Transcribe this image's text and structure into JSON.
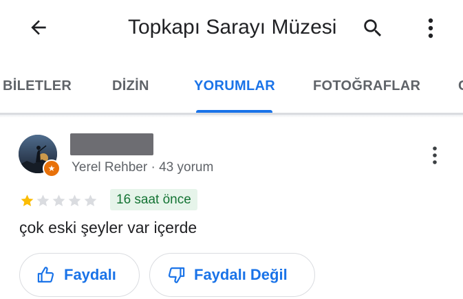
{
  "app_bar": {
    "title": "Topkapı Sarayı Müzesi",
    "icons": [
      "back-arrow-icon",
      "search-icon",
      "more-vert-icon"
    ]
  },
  "tabs": [
    {
      "label": "BİLETLER",
      "active": false
    },
    {
      "label": "DİZİN",
      "active": false
    },
    {
      "label": "YORUMLAR",
      "active": true
    },
    {
      "label": "FOTOĞRAFLAR",
      "active": false
    }
  ],
  "review": {
    "author_meta": "Yerel Rehber · 43 yorum",
    "rating": 1,
    "rating_max": 5,
    "time": "16 saat önce",
    "text": "çok eski şeyler var içerde",
    "helpful_label": "Faydalı",
    "not_helpful_label": "Faydalı Değil"
  },
  "colors": {
    "accent": "#1a73e8",
    "star_filled": "#fbbc04",
    "star_empty": "#dadce0",
    "time_chip_bg": "#e6f4ea",
    "time_chip_text": "#137333",
    "local_guide_badge": "#e8710a"
  }
}
